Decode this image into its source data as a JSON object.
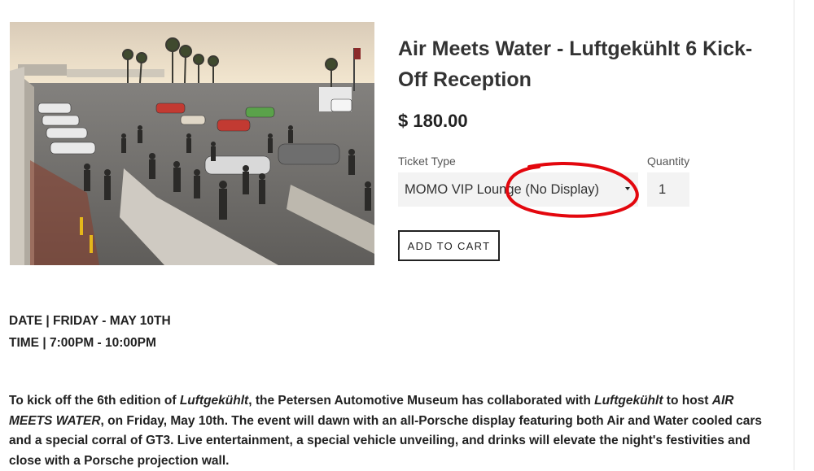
{
  "product": {
    "title": "Air Meets Water - Luftgekühlt 6 Kick-Off Reception",
    "price": "$ 180.00",
    "image_description": "Rooftop event with crowd and Porsche cars"
  },
  "form": {
    "ticket_type_label": "Ticket Type",
    "ticket_type_value": "MOMO VIP Lounge (No Display)",
    "quantity_label": "Quantity",
    "quantity_value": "1",
    "add_to_cart_label": "ADD TO CART",
    "annotation_color": "#e3070e"
  },
  "details": {
    "date": "DATE | FRIDAY - MAY 10TH",
    "time": "TIME | 7:00PM - 10:00PM"
  },
  "description": {
    "p1": "To kick off the 6th edition of ",
    "em1": "Luftgekühlt",
    "p2": ", the Petersen Automotive Museum has collaborated with ",
    "em2": "Luftgekühlt",
    "p3": " to host ",
    "em3": "AIR MEETS WATER",
    "p4": ", on Friday, May 10th. The event will dawn with an all-Porsche display featuring both Air and Water cooled cars and a special corral of GT3. Live entertainment, a special vehicle unveiling, and drinks will elevate the night's festivities and close with a Porsche projection wall."
  }
}
